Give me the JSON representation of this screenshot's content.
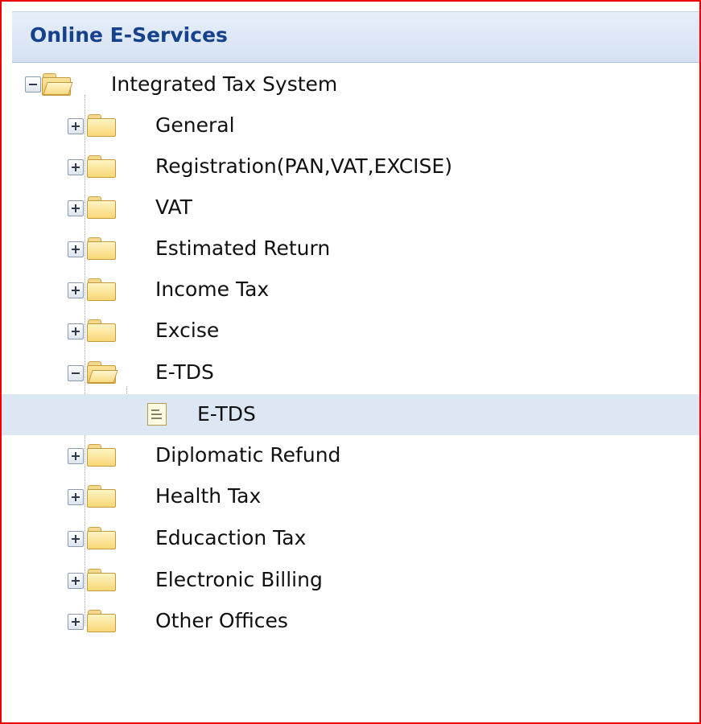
{
  "panel": {
    "title": "Online E-Services"
  },
  "tree": {
    "root": {
      "label": "Integrated Tax System",
      "icon": "folder-open-icon",
      "expander": "collapse"
    },
    "items": [
      {
        "label": "General",
        "icon": "folder-icon",
        "expander": "expand"
      },
      {
        "label": "Registration(PAN,VAT,EXCISE)",
        "icon": "folder-icon",
        "expander": "expand"
      },
      {
        "label": "VAT",
        "icon": "folder-icon",
        "expander": "expand"
      },
      {
        "label": "Estimated Return",
        "icon": "folder-icon",
        "expander": "expand"
      },
      {
        "label": "Income Tax",
        "icon": "folder-icon",
        "expander": "expand"
      },
      {
        "label": "Excise",
        "icon": "folder-icon",
        "expander": "expand"
      },
      {
        "label": "E-TDS",
        "icon": "folder-open-icon",
        "expander": "collapse",
        "children": [
          {
            "label": "E-TDS",
            "icon": "document-icon",
            "selected": true
          }
        ]
      },
      {
        "label": "Diplomatic Refund",
        "icon": "folder-icon",
        "expander": "expand"
      },
      {
        "label": "Health Tax",
        "icon": "folder-icon",
        "expander": "expand"
      },
      {
        "label": "Educaction Tax",
        "icon": "folder-icon",
        "expander": "expand"
      },
      {
        "label": "Electronic Billing",
        "icon": "folder-icon",
        "expander": "expand"
      },
      {
        "label": "Other Offices",
        "icon": "folder-icon",
        "expander": "expand"
      }
    ]
  },
  "colors": {
    "frame_border": "#ee0000",
    "header_text": "#15428b",
    "selected_row": "#dde6f3"
  }
}
